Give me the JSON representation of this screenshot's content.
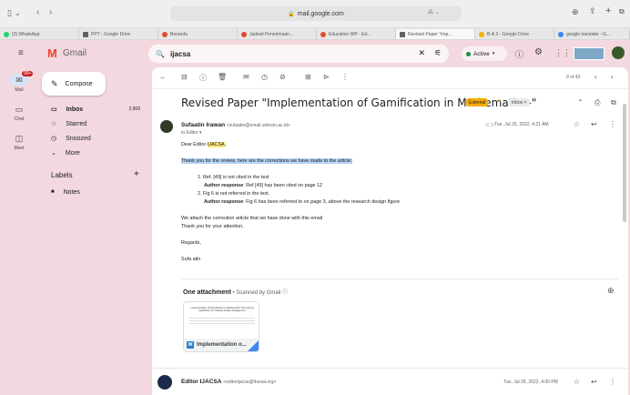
{
  "browser": {
    "url": "mail.google.com",
    "tabs": [
      {
        "label": "(3) WhatsApp",
        "color": "#25d366"
      },
      {
        "label": "PPT - Google Drive",
        "color": "#5f6368"
      },
      {
        "label": "Beranda",
        "color": "#e04a2f"
      },
      {
        "label": "Jadwal Penerimaan...",
        "color": "#e04a2f"
      },
      {
        "label": "Education WP - Ed...",
        "color": "#e04a2f"
      },
      {
        "label": "Revised Paper \"Imp...",
        "color": "#5f6368"
      },
      {
        "label": "B.A.2 - Google Drive",
        "color": "#f4b400"
      },
      {
        "label": "google translate - G...",
        "color": "#4285f4"
      }
    ]
  },
  "gmail": {
    "logo": "Gmail",
    "search_value": "ijacsa",
    "status": "Active",
    "mail_badge": "99+"
  },
  "rail": [
    {
      "icon": "mail-icon",
      "label": "Mail"
    },
    {
      "icon": "chat-icon",
      "label": "Chat"
    },
    {
      "icon": "meet-icon",
      "label": "Meet"
    }
  ],
  "nav": {
    "compose": "Compose",
    "items": [
      {
        "label": "Inbox",
        "count": "2,909"
      },
      {
        "label": "Starred",
        "count": ""
      },
      {
        "label": "Snoozed",
        "count": ""
      },
      {
        "label": "More",
        "count": ""
      }
    ],
    "labels_title": "Labels",
    "labels": [
      {
        "label": "Notes"
      }
    ]
  },
  "pager": "9 of 43",
  "email": {
    "subject": "Revised Paper \"Implementation of Gamification in Mathematics-\"",
    "chip_external": "External",
    "chip_inbox": "Inbox ×",
    "sender_name": "Sufaatin Irawan",
    "sender_email": "<sufaatin@email.unikom.ac.id>",
    "to": "to Editor ▾",
    "date": "Tue, Jul 26, 2022, 4:21 AM",
    "greeting_prefix": "Dear Editor ",
    "greeting_name": "IJACSA",
    "greeting_suffix": ",",
    "intro": "Thank you for the review, here are the corrections we have made to the article:",
    "item1": "1. Ref. [49] is not cited in the text",
    "resp1_label": "Author response",
    "resp1": ": Ref [49] has been cited on page 12",
    "item2": "2. Fig 6 is not referred in the text.",
    "resp2_label": "Author response",
    "resp2": ": Fig 6 has been referred to on page 3, above the research design figure",
    "attach_line1": "We attach the correction article that we have done with this email",
    "attach_line2": "Thank you for your attention.",
    "regards": "Regards,",
    "signature": "Sufa atin"
  },
  "attachment": {
    "title": "One attachment",
    "scanned": " • Scanned by Gmail ⓘ",
    "file": "Implementation o...",
    "thumb_title": "Implementation Of Gamification in Mathematics- M-Learning Application To Creating Student Engagement"
  },
  "next_message": {
    "sender_name": "Editor IJACSA",
    "sender_email": "<editorijacsa@thesai.org>",
    "date": "Tue, Jul 26, 2022, 4:00 PM"
  }
}
